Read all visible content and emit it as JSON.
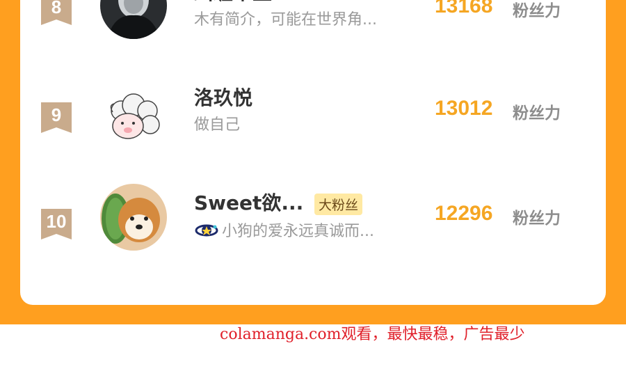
{
  "rows": [
    {
      "rank": "8",
      "name": "纠缠半生",
      "bio": "木有简介，可能在世界角...",
      "score": "13168",
      "unit": "粉丝力",
      "avatar": "dark-hooded-character-avatar"
    },
    {
      "rank": "9",
      "name": "洛玖悦",
      "bio": "做自己",
      "score": "13012",
      "unit": "粉丝力",
      "avatar": "cartoon-sheep-avatar"
    },
    {
      "rank": "10",
      "name": "Sweet欲...",
      "badge": "大粉丝",
      "bio": "小狗的爱永远真诚而...",
      "score": "12296",
      "unit": "粉丝力",
      "avatar": "shiba-dog-avatar",
      "bio_icon": "orbit-star-icon"
    }
  ],
  "footer": {
    "watermark": "colamanga.com观看，最快最稳，广告最少"
  },
  "colors": {
    "background": "#FF9F1F",
    "score": "#F5A623",
    "rank_badge": "#C9AB8C",
    "footer_text": "#e0202a"
  }
}
